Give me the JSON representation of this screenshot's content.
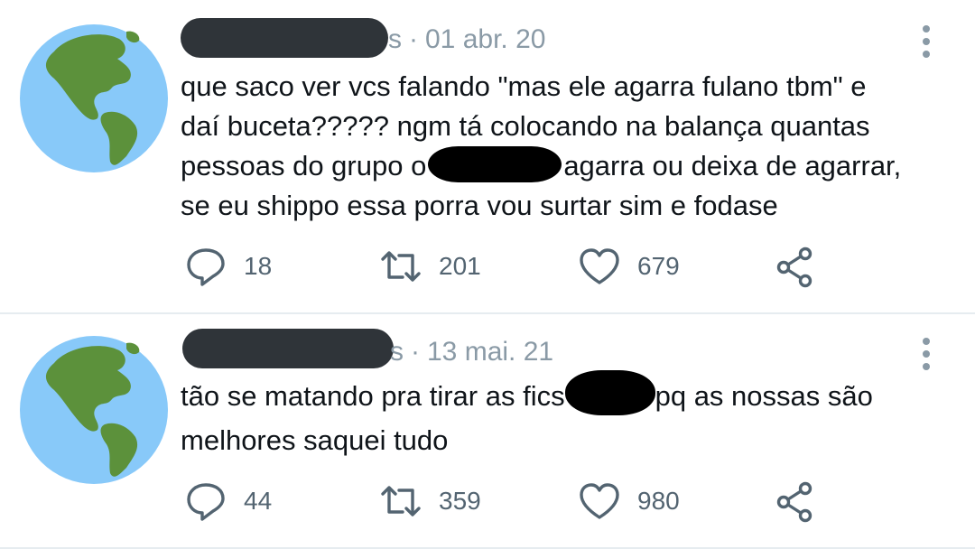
{
  "tweets": [
    {
      "handle_tail": "s",
      "separator": "·",
      "date": "01 abr. 20",
      "lines": [
        "que saco ver vcs falando \"mas ele agarra fulano tbm\" e",
        "daí buceta????? ngm tá colocando na balança quantas",
        "pessoas do grupo o",
        "agarra ou deixa de agarrar,",
        "se eu shippo essa porra vou surtar sim e fodase"
      ],
      "replies": "18",
      "retweets": "201",
      "likes": "679"
    },
    {
      "handle_tail": "s",
      "separator": "·",
      "date": "13 mai. 21",
      "lines": [
        "tão se matando pra tirar as fics",
        "pq as nossas são",
        "melhores saquei tudo"
      ],
      "replies": "44",
      "retweets": "359",
      "likes": "980"
    }
  ],
  "icons": {
    "avatar": "globe-icon",
    "more": "more-vertical-icon",
    "reply": "reply-icon",
    "retweet": "retweet-icon",
    "like": "heart-icon",
    "share": "share-icon"
  },
  "colors": {
    "text": "#0f1419",
    "muted": "#536471",
    "ocean": "#88c9f9",
    "land": "#5c913b",
    "redaction": "#2f3439"
  }
}
